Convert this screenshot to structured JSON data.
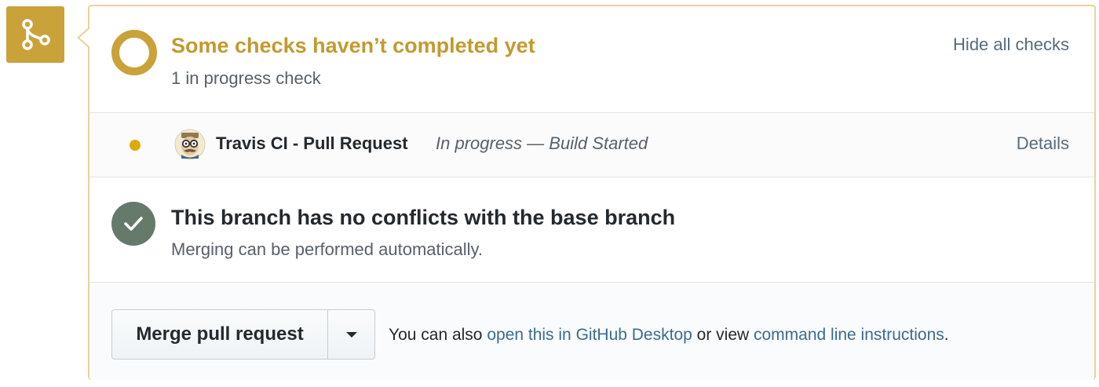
{
  "colors": {
    "pending_accent": "#c9a23a",
    "pending_title": "#c39a2f",
    "panel_border": "#e9d39a",
    "success_circle": "#667a6c",
    "link": "#3a6c8f"
  },
  "merge_icon": {
    "icon": "git-merge-icon"
  },
  "checks": {
    "status_icon": "pending-ring-icon",
    "title": "Some checks haven’t completed yet",
    "subtitle": "1 in progress check",
    "toggle_label": "Hide all checks"
  },
  "check_items": [
    {
      "status_icon": "in-progress-dot-icon",
      "avatar_icon": "travis-ci-mascot-icon",
      "name": "Travis CI - Pull Request",
      "status": "In progress — Build Started",
      "details_label": "Details"
    }
  ],
  "conflicts": {
    "status_icon": "check-icon",
    "title": "This branch has no conflicts with the base branch",
    "subtitle": "Merging can be performed automatically."
  },
  "merge": {
    "button_label": "Merge pull request",
    "dropdown_icon": "triangle-down-icon",
    "note_prefix": "You can also ",
    "desktop_link": "open this in GitHub Desktop",
    "note_middle": " or view ",
    "cli_link": "command line instructions",
    "note_suffix": "."
  }
}
